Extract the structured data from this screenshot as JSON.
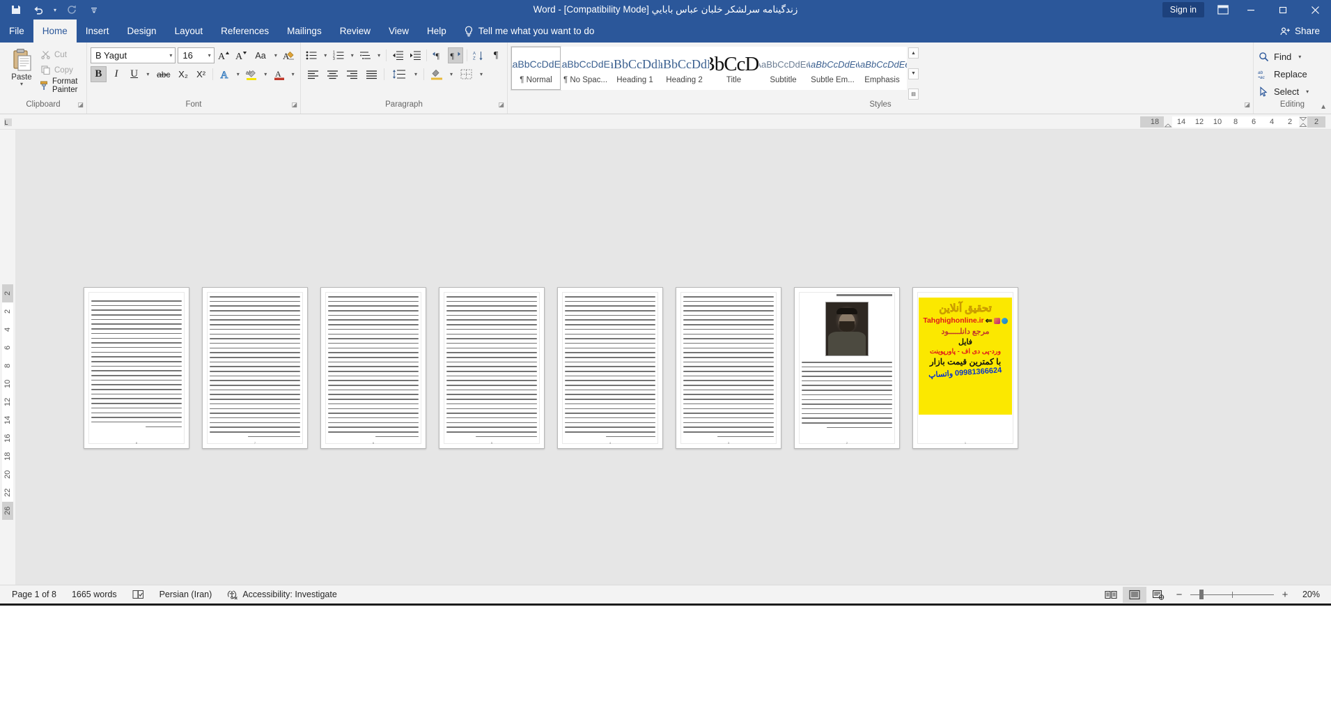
{
  "titlebar": {
    "quick_access": [
      {
        "name": "save-icon",
        "label": "Save"
      },
      {
        "name": "undo-icon",
        "label": "Undo"
      },
      {
        "name": "redo-icon",
        "label": "Repeat"
      },
      {
        "name": "customize-qat-icon",
        "label": "Customize Quick Access Toolbar"
      }
    ],
    "document_title": "زندگینامه سرلشکر خلبان عباس بابايي [Compatibility Mode]  -  Word",
    "sign_in": "Sign in",
    "ribbon_display_options": "Ribbon Display Options",
    "minimize": "Minimize",
    "restore": "Restore Down",
    "close": "Close"
  },
  "tabs": [
    {
      "label": "File",
      "active": false
    },
    {
      "label": "Home",
      "active": true
    },
    {
      "label": "Insert",
      "active": false
    },
    {
      "label": "Design",
      "active": false
    },
    {
      "label": "Layout",
      "active": false
    },
    {
      "label": "References",
      "active": false
    },
    {
      "label": "Mailings",
      "active": false
    },
    {
      "label": "Review",
      "active": false
    },
    {
      "label": "View",
      "active": false
    },
    {
      "label": "Help",
      "active": false
    }
  ],
  "tell_me": "Tell me what you want to do",
  "share": "Share",
  "ribbon": {
    "groups": [
      {
        "name": "Clipboard"
      },
      {
        "name": "Font"
      },
      {
        "name": "Paragraph"
      },
      {
        "name": "Styles"
      },
      {
        "name": "Editing"
      }
    ],
    "clipboard": {
      "paste_label": "Paste",
      "cut": "Cut",
      "copy": "Copy",
      "format_painter": "Format Painter"
    },
    "font": {
      "font_name": "B Yagut",
      "font_size": "16",
      "grow_font": "Grow Font",
      "shrink_font": "Shrink Font",
      "change_case": "Aa",
      "clear_formatting": "Clear All Formatting",
      "bold": "B",
      "italic": "I",
      "underline": "U",
      "strikethrough": "abc",
      "subscript": "X₂",
      "superscript": "X²",
      "text_effects": "A",
      "highlight": "ab",
      "font_color": "A"
    },
    "paragraph": {
      "bullets": "Bullets",
      "numbering": "Numbering",
      "multilevel": "Multilevel List",
      "decrease_indent": "Decrease Indent",
      "increase_indent": "Increase Indent",
      "rtl_paragraph": "Right-to-Left Text Direction",
      "ltr_paragraph": "Left-to-Right Text Direction",
      "sort": "Sort",
      "show_marks": "Show/Hide ¶",
      "align_left": "Align Left",
      "center": "Center",
      "align_right": "Align Right",
      "justify": "Justify",
      "line_spacing": "Line and Paragraph Spacing",
      "shading": "Shading",
      "borders": "Borders"
    },
    "styles": [
      {
        "preview": "AaBbCcDdEe",
        "name": "¶ Normal",
        "selected": true,
        "kind": "normal"
      },
      {
        "preview": "AaBbCcDdEe",
        "name": "¶ No Spac...",
        "selected": false,
        "kind": "normal"
      },
      {
        "preview": "AaBbCcDdEe",
        "name": "Heading 1",
        "selected": false,
        "kind": "h1"
      },
      {
        "preview": "AaBbCcDdEe",
        "name": "Heading 2",
        "selected": false,
        "kind": "h2"
      },
      {
        "preview": "AaBbCcDdEe",
        "name": "Title",
        "selected": false,
        "kind": "title"
      },
      {
        "preview": "AaBbCcDdEe",
        "name": "Subtitle",
        "selected": false,
        "kind": "sub"
      },
      {
        "preview": "AaBbCcDdEe",
        "name": "Subtle Em...",
        "selected": false,
        "kind": "em"
      },
      {
        "preview": "AaBbCcDdEe",
        "name": "Emphasis",
        "selected": false,
        "kind": "em"
      }
    ],
    "editing": {
      "find": "Find",
      "replace": "Replace",
      "select": "Select"
    }
  },
  "rulers": {
    "horizontal_numbers": [
      "18",
      "14",
      "12",
      "10",
      "8",
      "6",
      "4",
      "2",
      "2"
    ],
    "vertical_numbers": [
      "2",
      "2",
      "4",
      "6",
      "8",
      "10",
      "12",
      "14",
      "16",
      "18",
      "20",
      "22",
      "26"
    ]
  },
  "document": {
    "pages": [
      {
        "index": 1,
        "type": "ad",
        "page_label": "1"
      },
      {
        "index": 2,
        "type": "photo",
        "page_label": "2"
      },
      {
        "index": 3,
        "type": "text",
        "page_label": "3"
      },
      {
        "index": 4,
        "type": "text",
        "page_label": "4"
      },
      {
        "index": 5,
        "type": "text",
        "page_label": "5"
      },
      {
        "index": 6,
        "type": "text",
        "page_label": "6"
      },
      {
        "index": 7,
        "type": "text",
        "page_label": "7"
      },
      {
        "index": 8,
        "type": "text",
        "page_label": "8"
      }
    ],
    "ad": {
      "line1": "تحقیق آنلاین",
      "line2": "Tahghighonline.ir",
      "line3": "مرجع دانلـــــود",
      "line4": "فایل",
      "line5": "ورد-پی دی اف - پاورپوینت",
      "line6": "با کمترین قیمت بازار",
      "line7": "09981366624 واتساپ"
    },
    "photo_page_heading": "زندگینامه سرلشکر خلبان عباس بابایی"
  },
  "statusbar": {
    "page": "Page 1 of 8",
    "words": "1665 words",
    "proofing": "Proofing errors",
    "language": "Persian (Iran)",
    "accessibility": "Accessibility: Investigate",
    "views": [
      {
        "name": "read-mode",
        "label": "Read Mode",
        "selected": false
      },
      {
        "name": "print-layout",
        "label": "Print Layout",
        "selected": true
      },
      {
        "name": "web-layout",
        "label": "Web Layout",
        "selected": false
      }
    ],
    "zoom_out": "−",
    "zoom_in": "+",
    "zoom_value": "20%"
  },
  "colors": {
    "word_blue": "#2b579a",
    "ribbon_bg": "#f3f3f3",
    "workspace_bg": "#e6e6e6",
    "ad_yellow": "#fbe800"
  }
}
